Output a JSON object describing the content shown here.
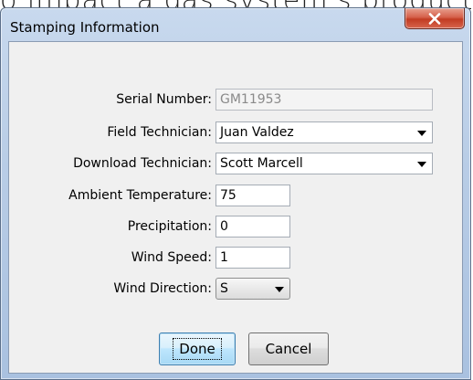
{
  "background": {
    "text": "o impact a gas system's production pe"
  },
  "window": {
    "title": "Stamping Information",
    "close_icon": "close-icon"
  },
  "form": {
    "serial_number": {
      "label": "Serial Number:",
      "value": "GM11953"
    },
    "field_technician": {
      "label": "Field Technician:",
      "value": "Juan Valdez"
    },
    "download_technician": {
      "label": "Download Technician:",
      "value": "Scott Marcell"
    },
    "ambient_temperature": {
      "label": "Ambient Temperature:",
      "value": "75"
    },
    "precipitation": {
      "label": "Precipitation:",
      "value": "0"
    },
    "wind_speed": {
      "label": "Wind Speed:",
      "value": "1"
    },
    "wind_direction": {
      "label": "Wind Direction:",
      "value": "S"
    }
  },
  "buttons": {
    "done": "Done",
    "cancel": "Cancel"
  },
  "colors": {
    "titlebar": "#b9cde6",
    "close_button": "#c23b22",
    "client": "#f0f0f0",
    "default_button": "#bee6fd"
  }
}
